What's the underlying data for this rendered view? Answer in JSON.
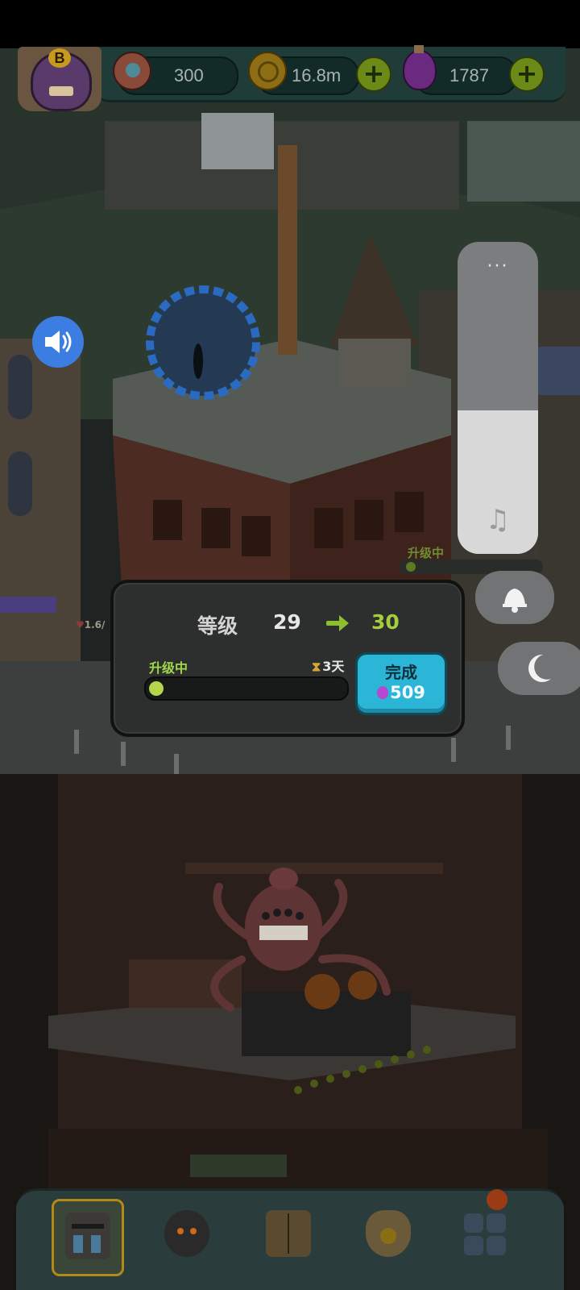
{
  "resources": {
    "eyes": "300",
    "coins": "16.8m",
    "potions": "1787"
  },
  "avatar": {
    "badge": "B"
  },
  "background_building": {
    "status_label": "升级中",
    "timer": "3天",
    "hp_label": "1.6/"
  },
  "upgrade_dialog": {
    "level_label": "等级",
    "level_from": "29",
    "level_to": "30",
    "status_label": "升级中",
    "timer": "3天",
    "progress": 0.03,
    "finish_button": {
      "label": "完成",
      "cost": "509"
    }
  },
  "volume_panel": {
    "menu_dots": "···",
    "music_icon": "music-note-icon",
    "level": 0.46
  },
  "side_buttons": [
    "bell-icon",
    "moon-icon"
  ],
  "bottom_nav": [
    {
      "name": "buildings",
      "icon": "building-icon",
      "selected": true
    },
    {
      "name": "monster",
      "icon": "monster-icon",
      "selected": false
    },
    {
      "name": "book",
      "icon": "book-icon",
      "selected": false
    },
    {
      "name": "bag",
      "icon": "coin-bag-icon",
      "selected": false
    },
    {
      "name": "grid",
      "icon": "grid-icon",
      "selected": false,
      "notification": true
    }
  ]
}
